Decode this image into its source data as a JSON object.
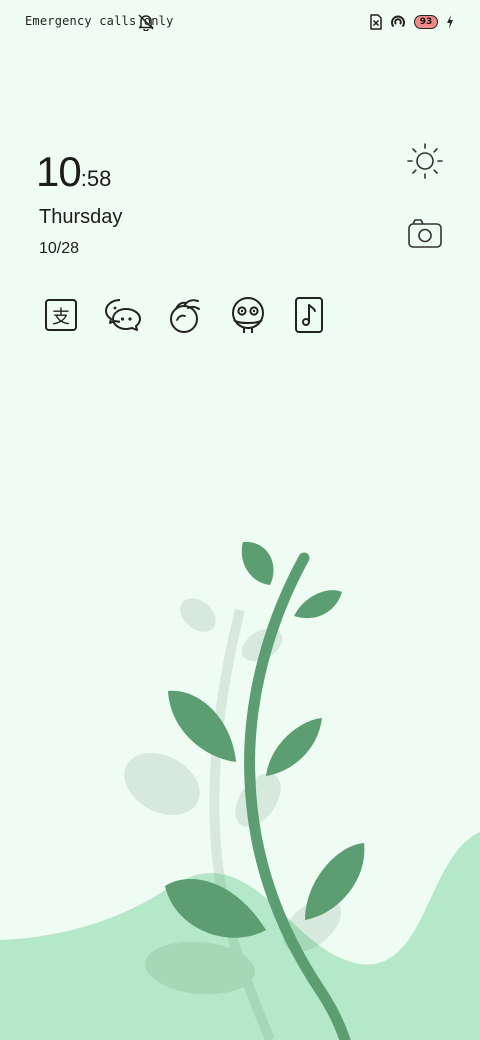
{
  "status_bar": {
    "carrier_text": "Emergency calls only",
    "battery_level": "93",
    "icons": [
      "bell-off-icon",
      "sim-missing-icon",
      "hotspot-icon",
      "battery-icon",
      "charging-icon"
    ]
  },
  "clock": {
    "hours": "10",
    "minutes": ":58"
  },
  "date": {
    "day": "Thursday",
    "date": "10/28"
  },
  "quick_actions": [
    "brightness-icon",
    "camera-icon"
  ],
  "app_shortcuts": [
    "alipay-icon",
    "wechat-icon",
    "peach-icon",
    "face-app-icon",
    "music-icon"
  ],
  "colors": {
    "background": "#effcf3",
    "leaf": "#5c9d72",
    "hill": "#b5e8c8",
    "battery_fill": "#f08a86"
  }
}
